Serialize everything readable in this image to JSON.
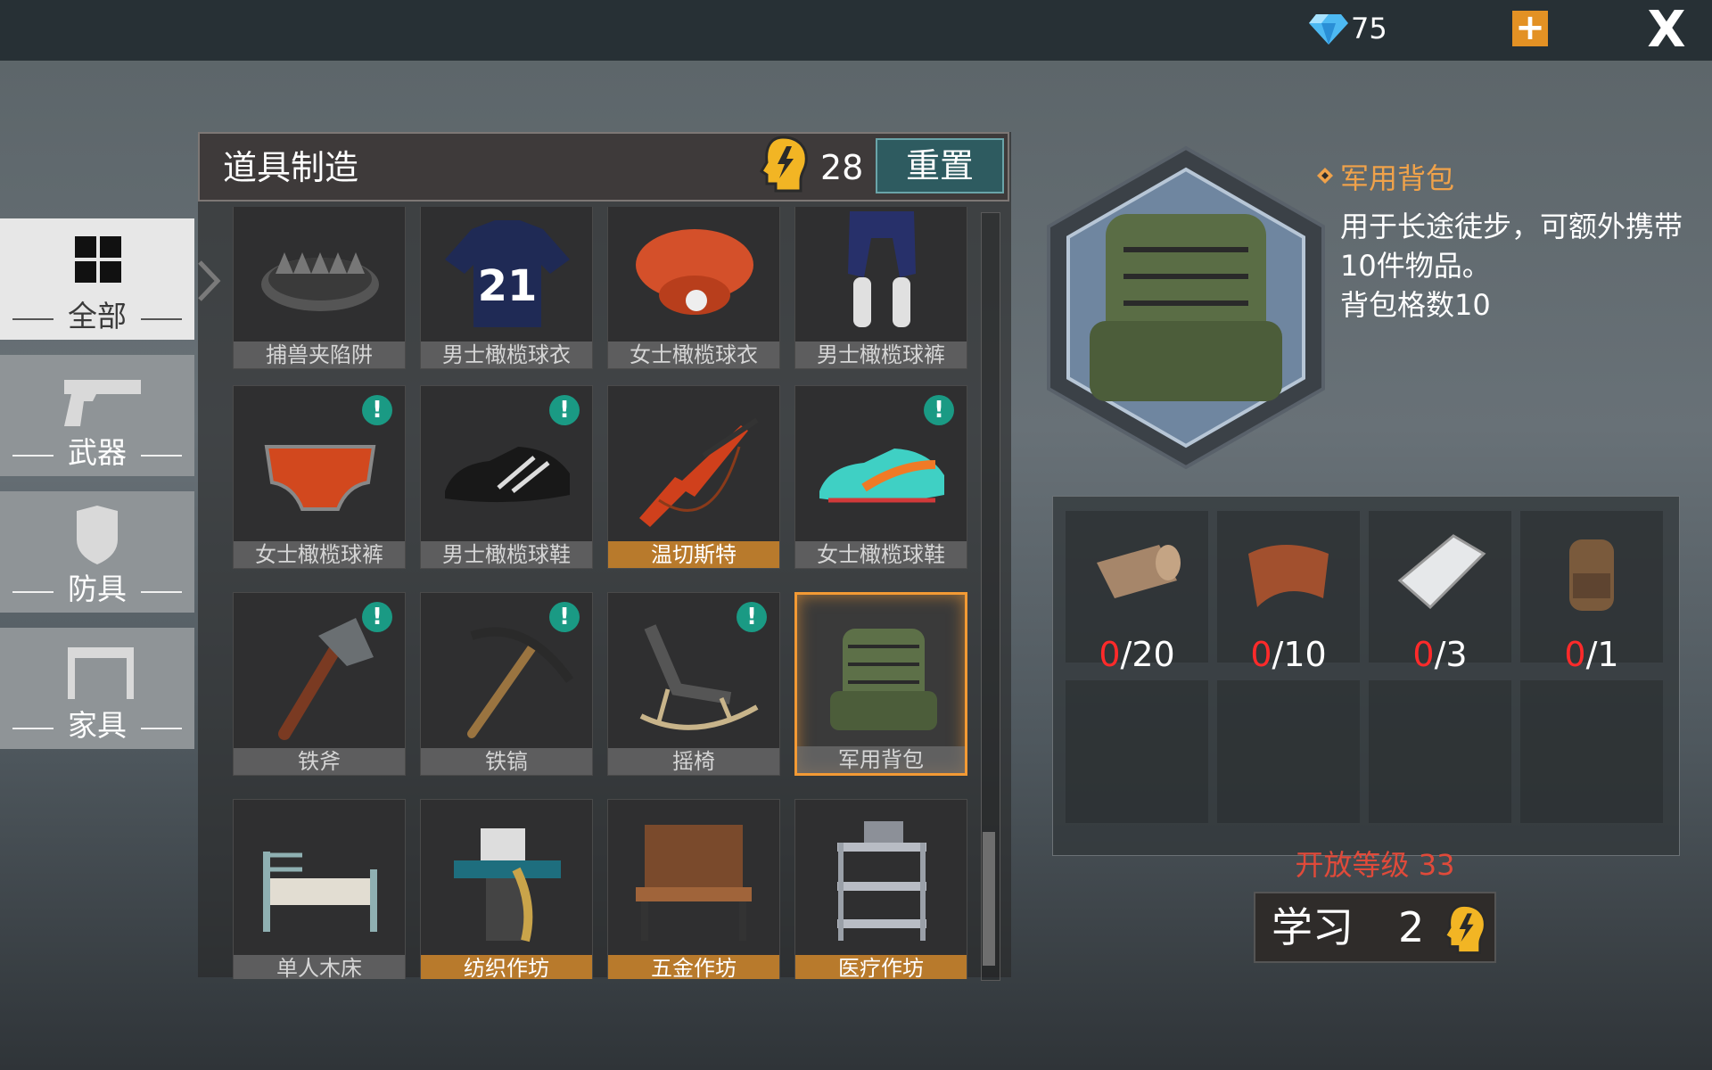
{
  "top": {
    "gems": "75"
  },
  "categories": [
    {
      "label": "全部",
      "icon": "grid-icon",
      "active": true
    },
    {
      "label": "武器",
      "icon": "pistol-icon",
      "active": false
    },
    {
      "label": "防具",
      "icon": "shield-icon",
      "active": false
    },
    {
      "label": "家具",
      "icon": "table-icon",
      "active": false
    }
  ],
  "header": {
    "title": "道具制造",
    "points": "28",
    "reset": "重置"
  },
  "items": [
    {
      "name": "捕兽夹陷阱",
      "icon": "trap-icon",
      "alert": false,
      "gold": false
    },
    {
      "name": "男士橄榄球衣",
      "icon": "jersey-icon",
      "alert": false,
      "gold": false
    },
    {
      "name": "女士橄榄球衣",
      "icon": "shoulderpad-icon",
      "alert": false,
      "gold": false
    },
    {
      "name": "男士橄榄球裤",
      "icon": "pants-icon",
      "alert": false,
      "gold": false
    },
    {
      "name": "女士橄榄球裤",
      "icon": "shorts-icon",
      "alert": true,
      "gold": false
    },
    {
      "name": "男士橄榄球鞋",
      "icon": "cleat-black-icon",
      "alert": true,
      "gold": false
    },
    {
      "name": "温切斯特",
      "icon": "rifle-icon",
      "alert": false,
      "gold": true
    },
    {
      "name": "女士橄榄球鞋",
      "icon": "cleat-teal-icon",
      "alert": true,
      "gold": false
    },
    {
      "name": "铁斧",
      "icon": "axe-icon",
      "alert": true,
      "gold": false
    },
    {
      "name": "铁镐",
      "icon": "pickaxe-icon",
      "alert": true,
      "gold": false
    },
    {
      "name": "摇椅",
      "icon": "rocking-chair-icon",
      "alert": true,
      "gold": false
    },
    {
      "name": "军用背包",
      "icon": "backpack-icon",
      "alert": false,
      "gold": false,
      "selected": true
    },
    {
      "name": "单人木床",
      "icon": "bed-icon",
      "alert": false,
      "gold": false
    },
    {
      "name": "纺织作坊",
      "icon": "sewing-station-icon",
      "alert": false,
      "gold": true
    },
    {
      "name": "五金作坊",
      "icon": "workbench-icon",
      "alert": false,
      "gold": true
    },
    {
      "name": "医疗作坊",
      "icon": "medical-station-icon",
      "alert": false,
      "gold": true
    }
  ],
  "detail": {
    "name": "军用背包",
    "desc": "用于长途徒步，可额外携带10件物品。",
    "stat": "背包格数10"
  },
  "materials": [
    {
      "icon": "leather-roll-icon",
      "have": "0",
      "need": "/20"
    },
    {
      "icon": "fabric-icon",
      "have": "0",
      "need": "/10"
    },
    {
      "icon": "metal-plate-icon",
      "have": "0",
      "need": "/3"
    },
    {
      "icon": "small-backpack-icon",
      "have": "0",
      "need": "/1"
    }
  ],
  "unlock": "开放等级 33",
  "learn": {
    "label": "学习",
    "cost": "2"
  },
  "colors": {
    "accent": "#f39a34",
    "alert": "#1a9a84",
    "gold_label": "#b87a2c",
    "missing": "#ff2a2a"
  }
}
